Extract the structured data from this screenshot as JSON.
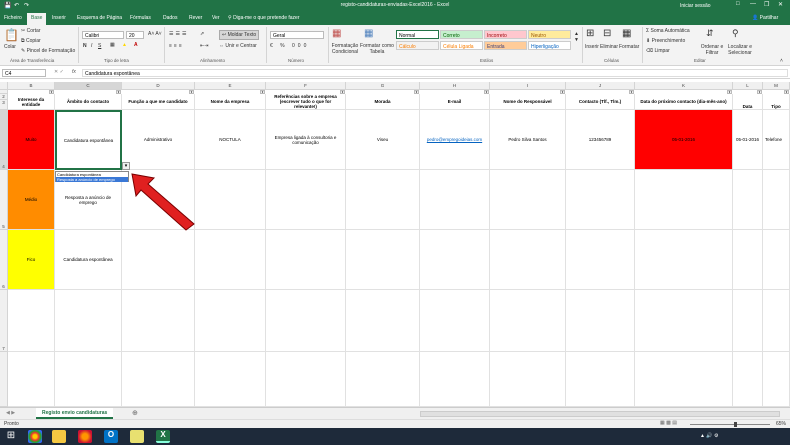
{
  "window": {
    "title": "registo-candidaturas-enviadas-Excel2016 - Excel",
    "signin": "Iniciar sessão"
  },
  "tabs": [
    "Ficheiro",
    "Base",
    "Inserir",
    "Esquema de Página",
    "Fórmulas",
    "Dados",
    "Rever",
    "Ver"
  ],
  "tellme": "Diga-me o que pretende fazer",
  "share": "Partilhar",
  "ribbon": {
    "paste": "Colar",
    "cut": "Cortar",
    "copy": "Copiar",
    "format_painter": "Pincel de Formatação",
    "font_name": "Calibri",
    "font_size": "20",
    "wrap": "Moldar Texto",
    "merge": "Unir e Centrar",
    "number_format": "Geral",
    "cond_format": "Formatação Condicional",
    "format_table": "Formatar como Tabela",
    "styles": [
      {
        "label": "Normal",
        "bg": "#ffffff",
        "fg": "#000000"
      },
      {
        "label": "Correto",
        "bg": "#c6efce",
        "fg": "#006100"
      },
      {
        "label": "Incorreto",
        "bg": "#ffc7ce",
        "fg": "#9c0006"
      },
      {
        "label": "Neutro",
        "bg": "#ffeb9c",
        "fg": "#9c5700"
      },
      {
        "label": "Cálculo",
        "bg": "#f2f2f2",
        "fg": "#fa7d00"
      },
      {
        "label": "Célula Ligada",
        "bg": "#ffffff",
        "fg": "#fa7d00"
      },
      {
        "label": "Entrada",
        "bg": "#ffcc99",
        "fg": "#3f3f76"
      },
      {
        "label": "Hiperligação",
        "bg": "#ffffff",
        "fg": "#0563c1"
      }
    ],
    "insert": "Inserir",
    "delete": "Eliminar",
    "format": "Formatar",
    "autosum": "Soma Automática",
    "fill": "Preenchimento",
    "clear": "Limpar",
    "sort": "Ordenar e Filtrar",
    "find": "Localizar e Selecionar",
    "groups": [
      "Área de Transferência",
      "Tipo de letra",
      "Alinhamento",
      "Número",
      "Estilos",
      "Células",
      "Editar"
    ]
  },
  "formula_bar": {
    "cell_ref": "C4",
    "fx": "fx",
    "content": "Candidatura espontânea"
  },
  "columns": [
    "B",
    "C",
    "D",
    "E",
    "F",
    "G",
    "H",
    "I",
    "J",
    "K",
    "L",
    "M"
  ],
  "rows": [
    "2",
    "3",
    "4",
    "5",
    "6",
    "7"
  ],
  "headers": {
    "b": "Interesse da entidade",
    "c": "Âmbito do contacto",
    "d": "Função a que me candidato",
    "e": "Nome da empresa",
    "f": "Referências sobre a empresa (escrever tudo o que for relevante!)",
    "g": "Morada",
    "h": "E-mail",
    "i": "Nome do Responsável",
    "j": "Contacto (Tlf., Tlm.)",
    "k": "Data do próximo contacto (dia-mês-ano)",
    "l": "Data",
    "m": "Tipo"
  },
  "data_rows": [
    {
      "interest": "Muito",
      "interest_color": "#ff0000",
      "scope": "Candidatura espontânea",
      "function": "Administrativo",
      "company": "NOCTULA",
      "refs": "Empresa ligada à consultoria e comunicação",
      "address": "Viseu",
      "email": "pedro@empregoideias.com",
      "manager": "Pedro Silva Santos",
      "phone": "123456789",
      "next_contact": "05-01-2016",
      "next_color": "#ff0000",
      "date": "05-01-2016",
      "type": "Telefone"
    },
    {
      "interest": "Médio",
      "interest_color": "#ff8c00",
      "scope": "Resposta a anúncio de emprego"
    },
    {
      "interest": "Fico",
      "interest_color": "#ffff00",
      "scope": "Candidatura espontânea"
    }
  ],
  "dropdown": {
    "options": [
      "Candidatura espontânea",
      "Resposta a anúncio de emprego"
    ]
  },
  "sheet_tab": "Registo envio candidaturas",
  "status": {
    "left": "Pronto",
    "zoom": "65%"
  }
}
